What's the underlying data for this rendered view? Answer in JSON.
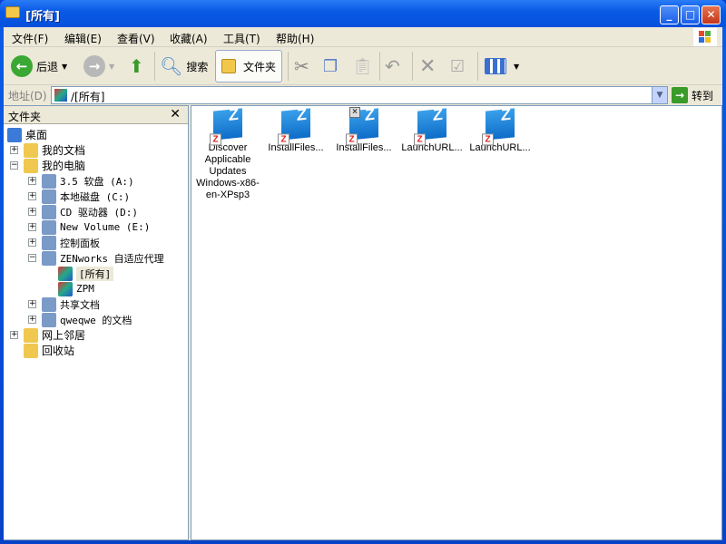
{
  "window": {
    "title": "[所有]",
    "min": "_",
    "max": "□",
    "close": "✕"
  },
  "menu": [
    "文件(F)",
    "编辑(E)",
    "查看(V)",
    "收藏(A)",
    "工具(T)",
    "帮助(H)"
  ],
  "toolbar": {
    "back": "后退",
    "search": "搜索",
    "folders": "文件夹"
  },
  "address": {
    "label": "地址(D)",
    "value": "/[所有]",
    "go": "转到"
  },
  "panel": {
    "title": "文件夹",
    "close": "✕"
  },
  "tree": [
    {
      "label": "桌面",
      "level": 0
    },
    {
      "label": "我的文档",
      "level": 1,
      "exp": "+"
    },
    {
      "label": "我的电脑",
      "level": 1,
      "exp": "−"
    },
    {
      "label": "3.5 软盘 (A:)",
      "level": 2,
      "exp": "+"
    },
    {
      "label": "本地磁盘 (C:)",
      "level": 2,
      "exp": "+"
    },
    {
      "label": "CD 驱动器 (D:)",
      "level": 2,
      "exp": "+"
    },
    {
      "label": "New Volume (E:)",
      "level": 2,
      "exp": "+"
    },
    {
      "label": "控制面板",
      "level": 2,
      "exp": "+"
    },
    {
      "label": "ZENworks 自适应代理",
      "level": 2,
      "exp": "−"
    },
    {
      "label": "[所有]",
      "level": 3,
      "selected": true
    },
    {
      "label": "ZPM",
      "level": 3
    },
    {
      "label": "共享文档",
      "level": 2,
      "exp": "+"
    },
    {
      "label": "qweqwe 的文档",
      "level": 2,
      "exp": "+"
    },
    {
      "label": "网上邻居",
      "level": 1,
      "exp": "+"
    },
    {
      "label": "回收站",
      "level": 1
    }
  ],
  "items": [
    {
      "label": "Discover Applicable Updates Windows-x86-en-XPsp3"
    },
    {
      "label": "InstallFiles..."
    },
    {
      "label": "InstallFiles...",
      "disabled": true
    },
    {
      "label": "LaunchURL..."
    },
    {
      "label": "LaunchURL..."
    }
  ]
}
